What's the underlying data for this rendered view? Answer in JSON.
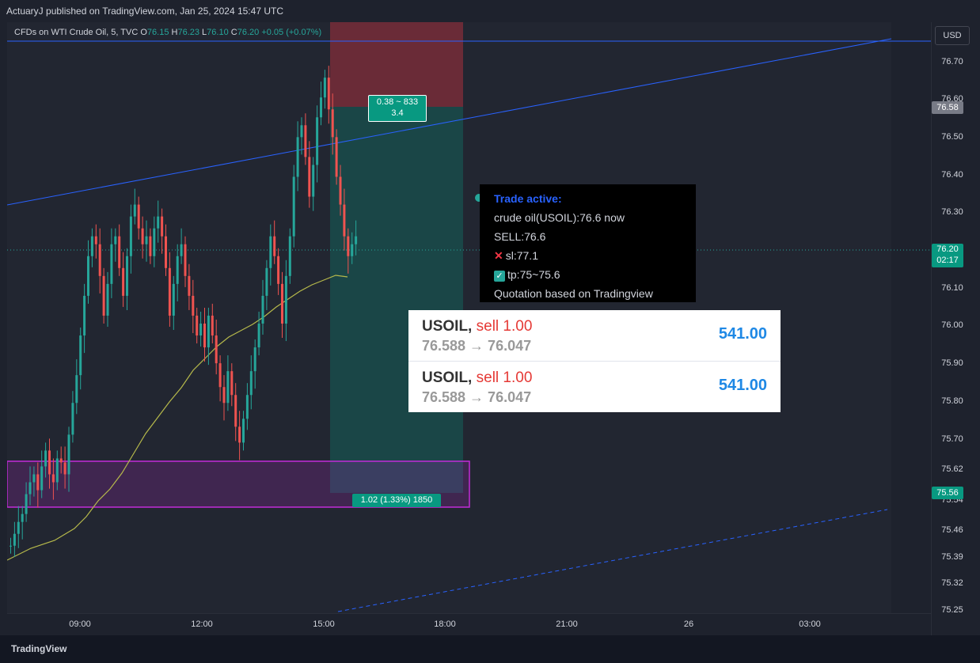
{
  "header": {
    "published_by": "ActuaryJ published on TradingView.com, Jan 25, 2024 15:47 UTC"
  },
  "symbol": {
    "name": "CFDs on WTI Crude Oil, 5, TVC",
    "open_label": "O",
    "open": "76.15",
    "high_label": "H",
    "high": "76.23",
    "low_label": "L",
    "low": "76.10",
    "close_label": "C",
    "close": "76.20",
    "change": "+0.05 (+0.07%)"
  },
  "currency_button": "USD",
  "price_axis": {
    "ticks": [
      "76.70",
      "76.60",
      "76.50",
      "76.40",
      "76.30",
      "76.10",
      "76.00",
      "75.90",
      "75.80",
      "75.70",
      "75.62",
      "75.54",
      "75.46",
      "75.39",
      "75.32",
      "75.25"
    ],
    "badge_stop": "76.58",
    "badge_current_price": "76.20",
    "badge_countdown": "02:17",
    "badge_target": "75.56"
  },
  "time_axis": [
    "09:00",
    "12:00",
    "15:00",
    "18:00",
    "21:00",
    "26",
    "03:00"
  ],
  "position_tool": {
    "risk_label_line1": "0.38 ~ 833",
    "risk_label_line2": "3.4",
    "reward_label": "1.02 (1.33%) 1850"
  },
  "info_box": {
    "title": "Trade active:",
    "line1": "crude oil(USOIL):76.6 now",
    "line2": "SELL:76.6",
    "sl": "sl:77.1",
    "tp": "tp:75~75.6",
    "line5": "Quotation based on Tradingview"
  },
  "orders": [
    {
      "symbol": "USOIL,",
      "side": "sell 1.00",
      "prices": "76.588 → 76.047",
      "profit": "541.00"
    },
    {
      "symbol": "USOIL,",
      "side": "sell 1.00",
      "prices": "76.588 → 76.047",
      "profit": "541.00"
    }
  ],
  "footer": {
    "brand": "TradingView"
  },
  "colors": {
    "bull": "#26a69a",
    "bear": "#ef5350",
    "trendline": "#2962ff",
    "ma": "#b6b94b",
    "zone": "#9c27b0"
  }
}
